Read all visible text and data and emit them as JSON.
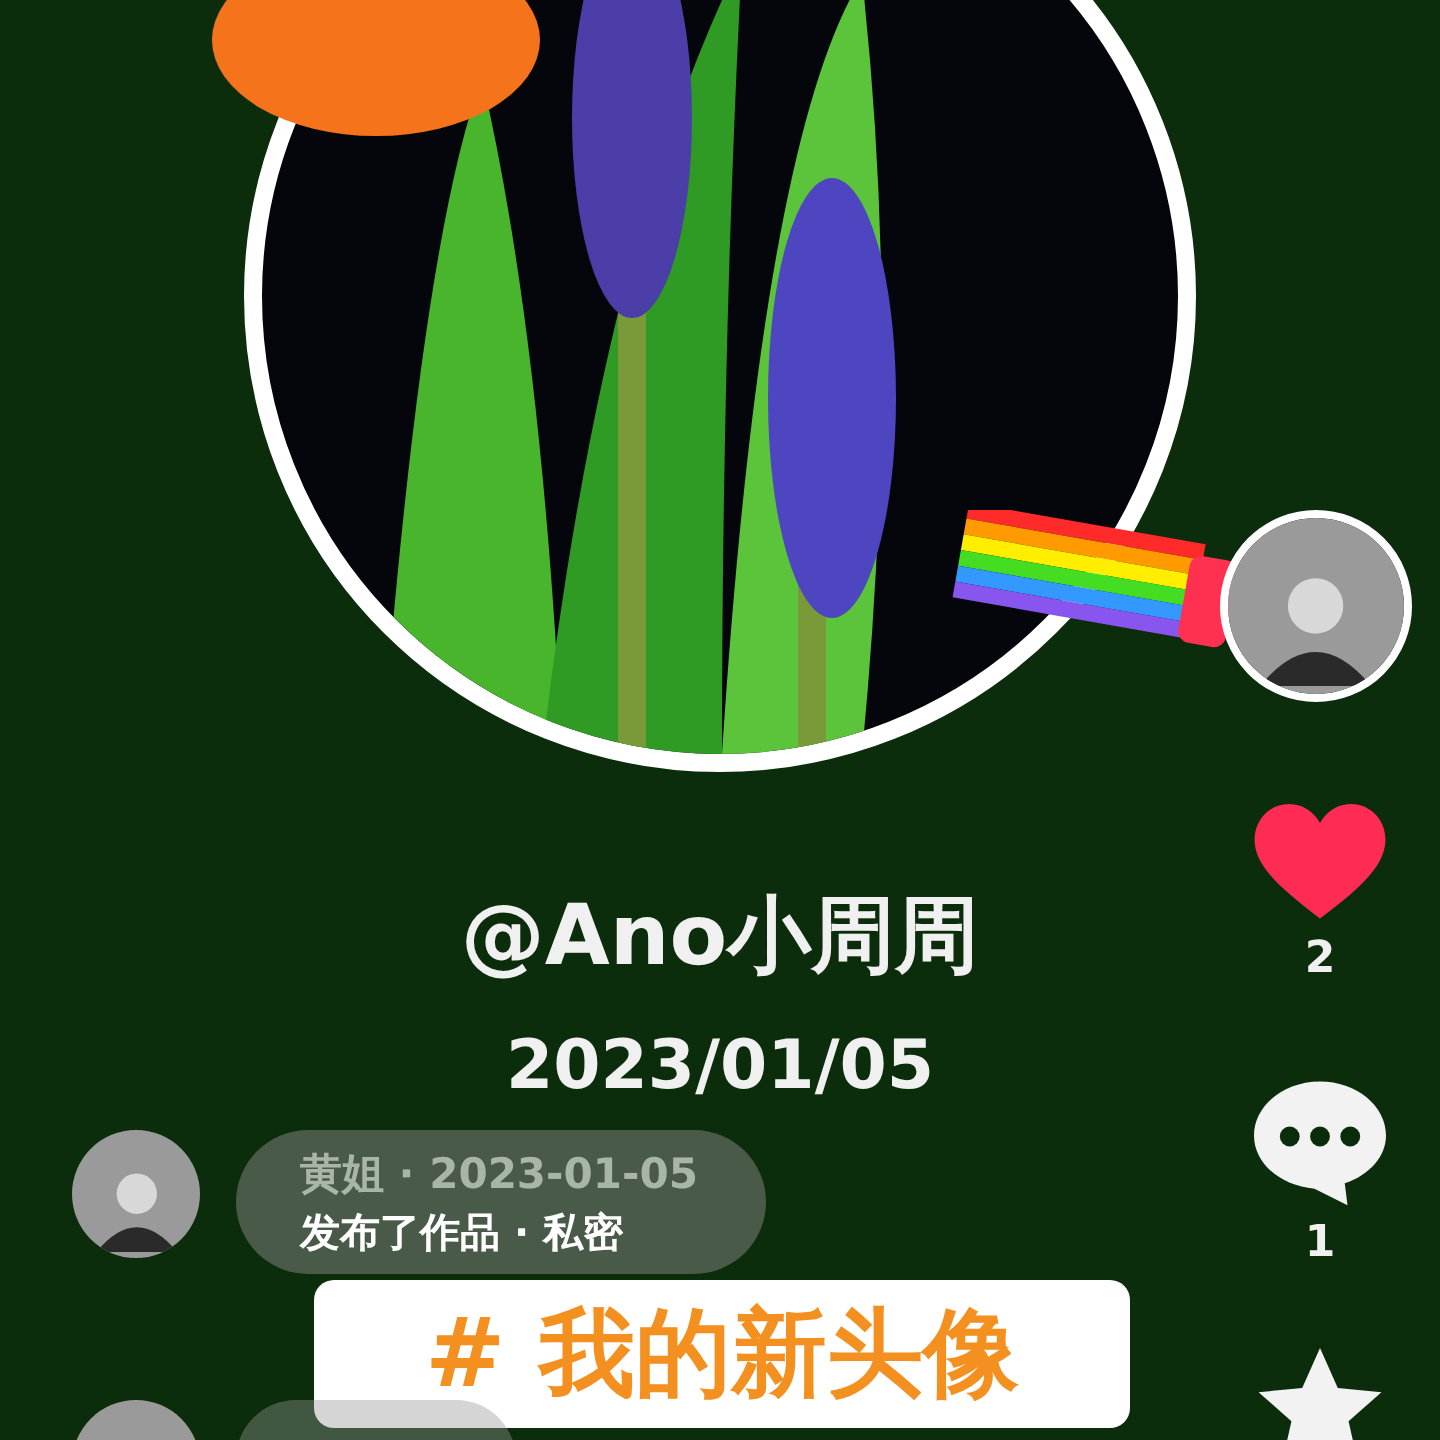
{
  "author": {
    "handle": "@Ano小周周",
    "date": "2023/01/05"
  },
  "actions": [
    {
      "kind": "like",
      "count": "2",
      "liked": true
    },
    {
      "kind": "comment",
      "count": "1"
    },
    {
      "kind": "favorite"
    }
  ],
  "comments": [
    {
      "meta": "黄姐 · 2023-01-05",
      "text": "发布了作品 · 私密"
    }
  ],
  "topic": "# 我的新头像"
}
